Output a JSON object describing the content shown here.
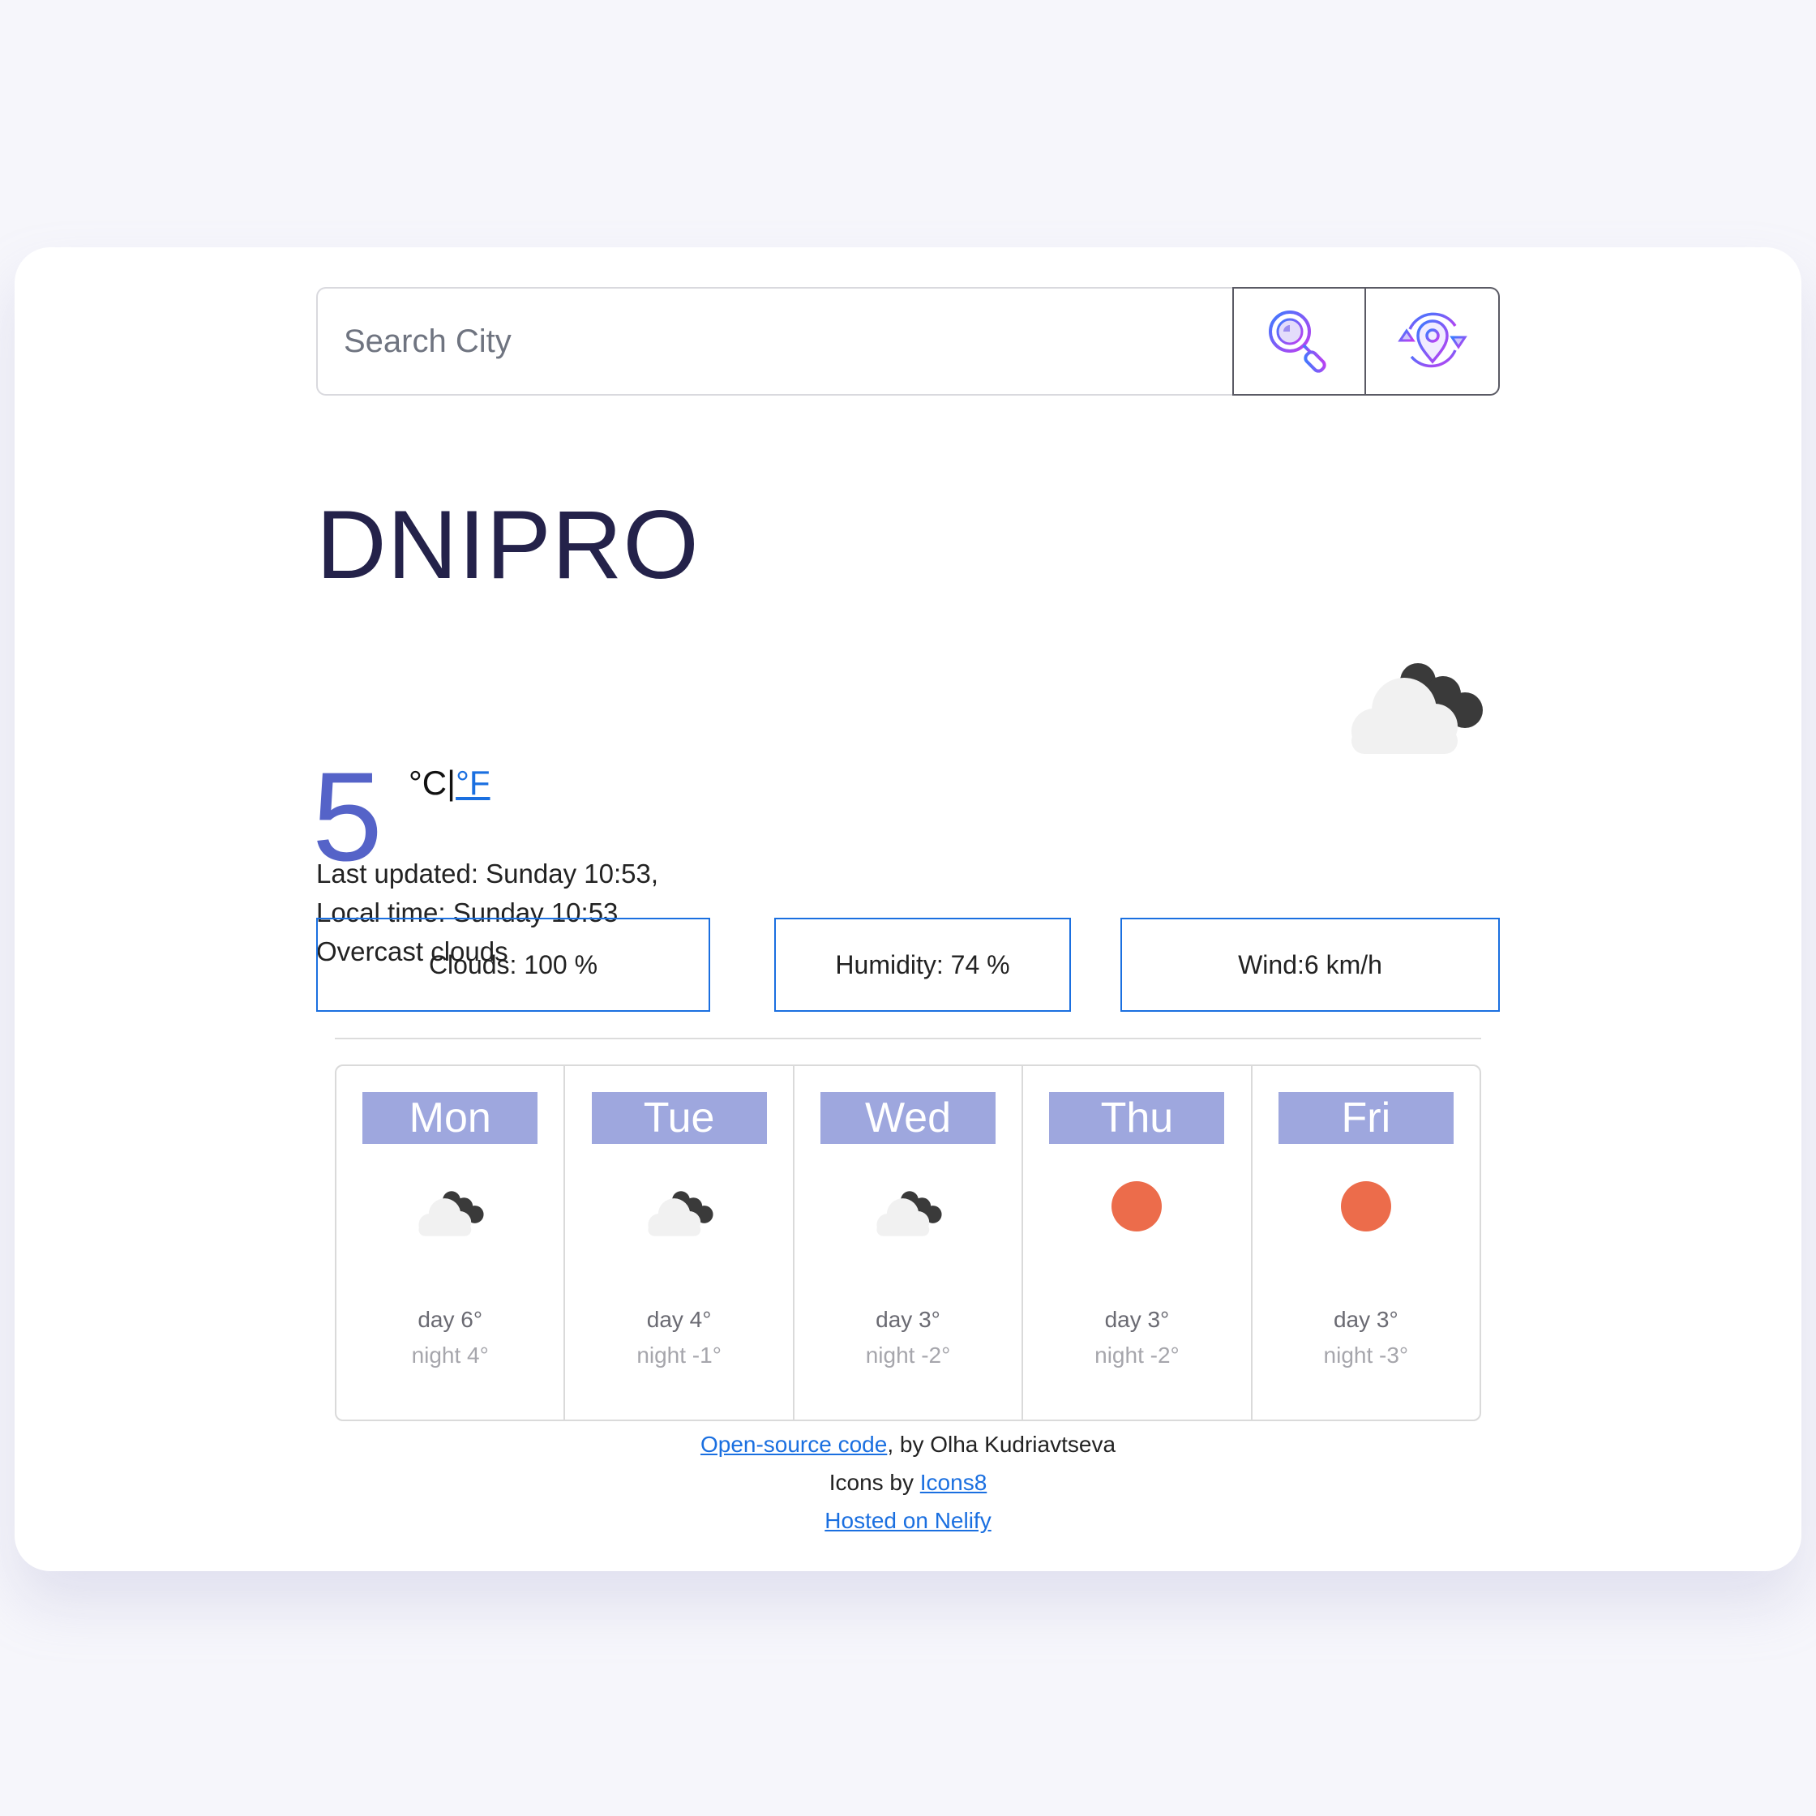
{
  "search": {
    "placeholder": "Search City",
    "search_icon": "magnifier-icon",
    "location_icon": "current-location-icon"
  },
  "city": {
    "name": "DNIPRO",
    "last_updated": "Last updated: Sunday 10:53,",
    "local_time": "Local time: Sunday 10:53",
    "description": "Overcast clouds",
    "icon": "overcast-cloud-icon"
  },
  "temperature": {
    "value": "5",
    "unit_c": "°C",
    "separator": "|",
    "unit_f": "°F"
  },
  "stats": {
    "clouds": "Clouds: 100 %",
    "humidity": "Humidity: 74 %",
    "wind": "Wind:6 km/h"
  },
  "forecast": [
    {
      "day": "Mon",
      "icon": "overcast-cloud-icon",
      "day_temp": "day 6°",
      "night_temp": "night 4°"
    },
    {
      "day": "Tue",
      "icon": "overcast-cloud-icon",
      "day_temp": "day 4°",
      "night_temp": "night -1°"
    },
    {
      "day": "Wed",
      "icon": "overcast-cloud-icon",
      "day_temp": "day 3°",
      "night_temp": "night -2°"
    },
    {
      "day": "Thu",
      "icon": "sun-icon",
      "day_temp": "day 3°",
      "night_temp": "night -2°"
    },
    {
      "day": "Fri",
      "icon": "sun-icon",
      "day_temp": "day 3°",
      "night_temp": "night -3°"
    }
  ],
  "footer": {
    "source_link": "Open-source code",
    "source_suffix": ", by Olha Kudriavtseva",
    "icons_prefix": "Icons by ",
    "icons_link": "Icons8",
    "hosted_link": "Hosted on Nelify"
  },
  "colors": {
    "accent": "#1a6fe0",
    "temperature": "#5563c8",
    "day_label_bg": "#9ea7de",
    "sun": "#ec6c4b"
  }
}
